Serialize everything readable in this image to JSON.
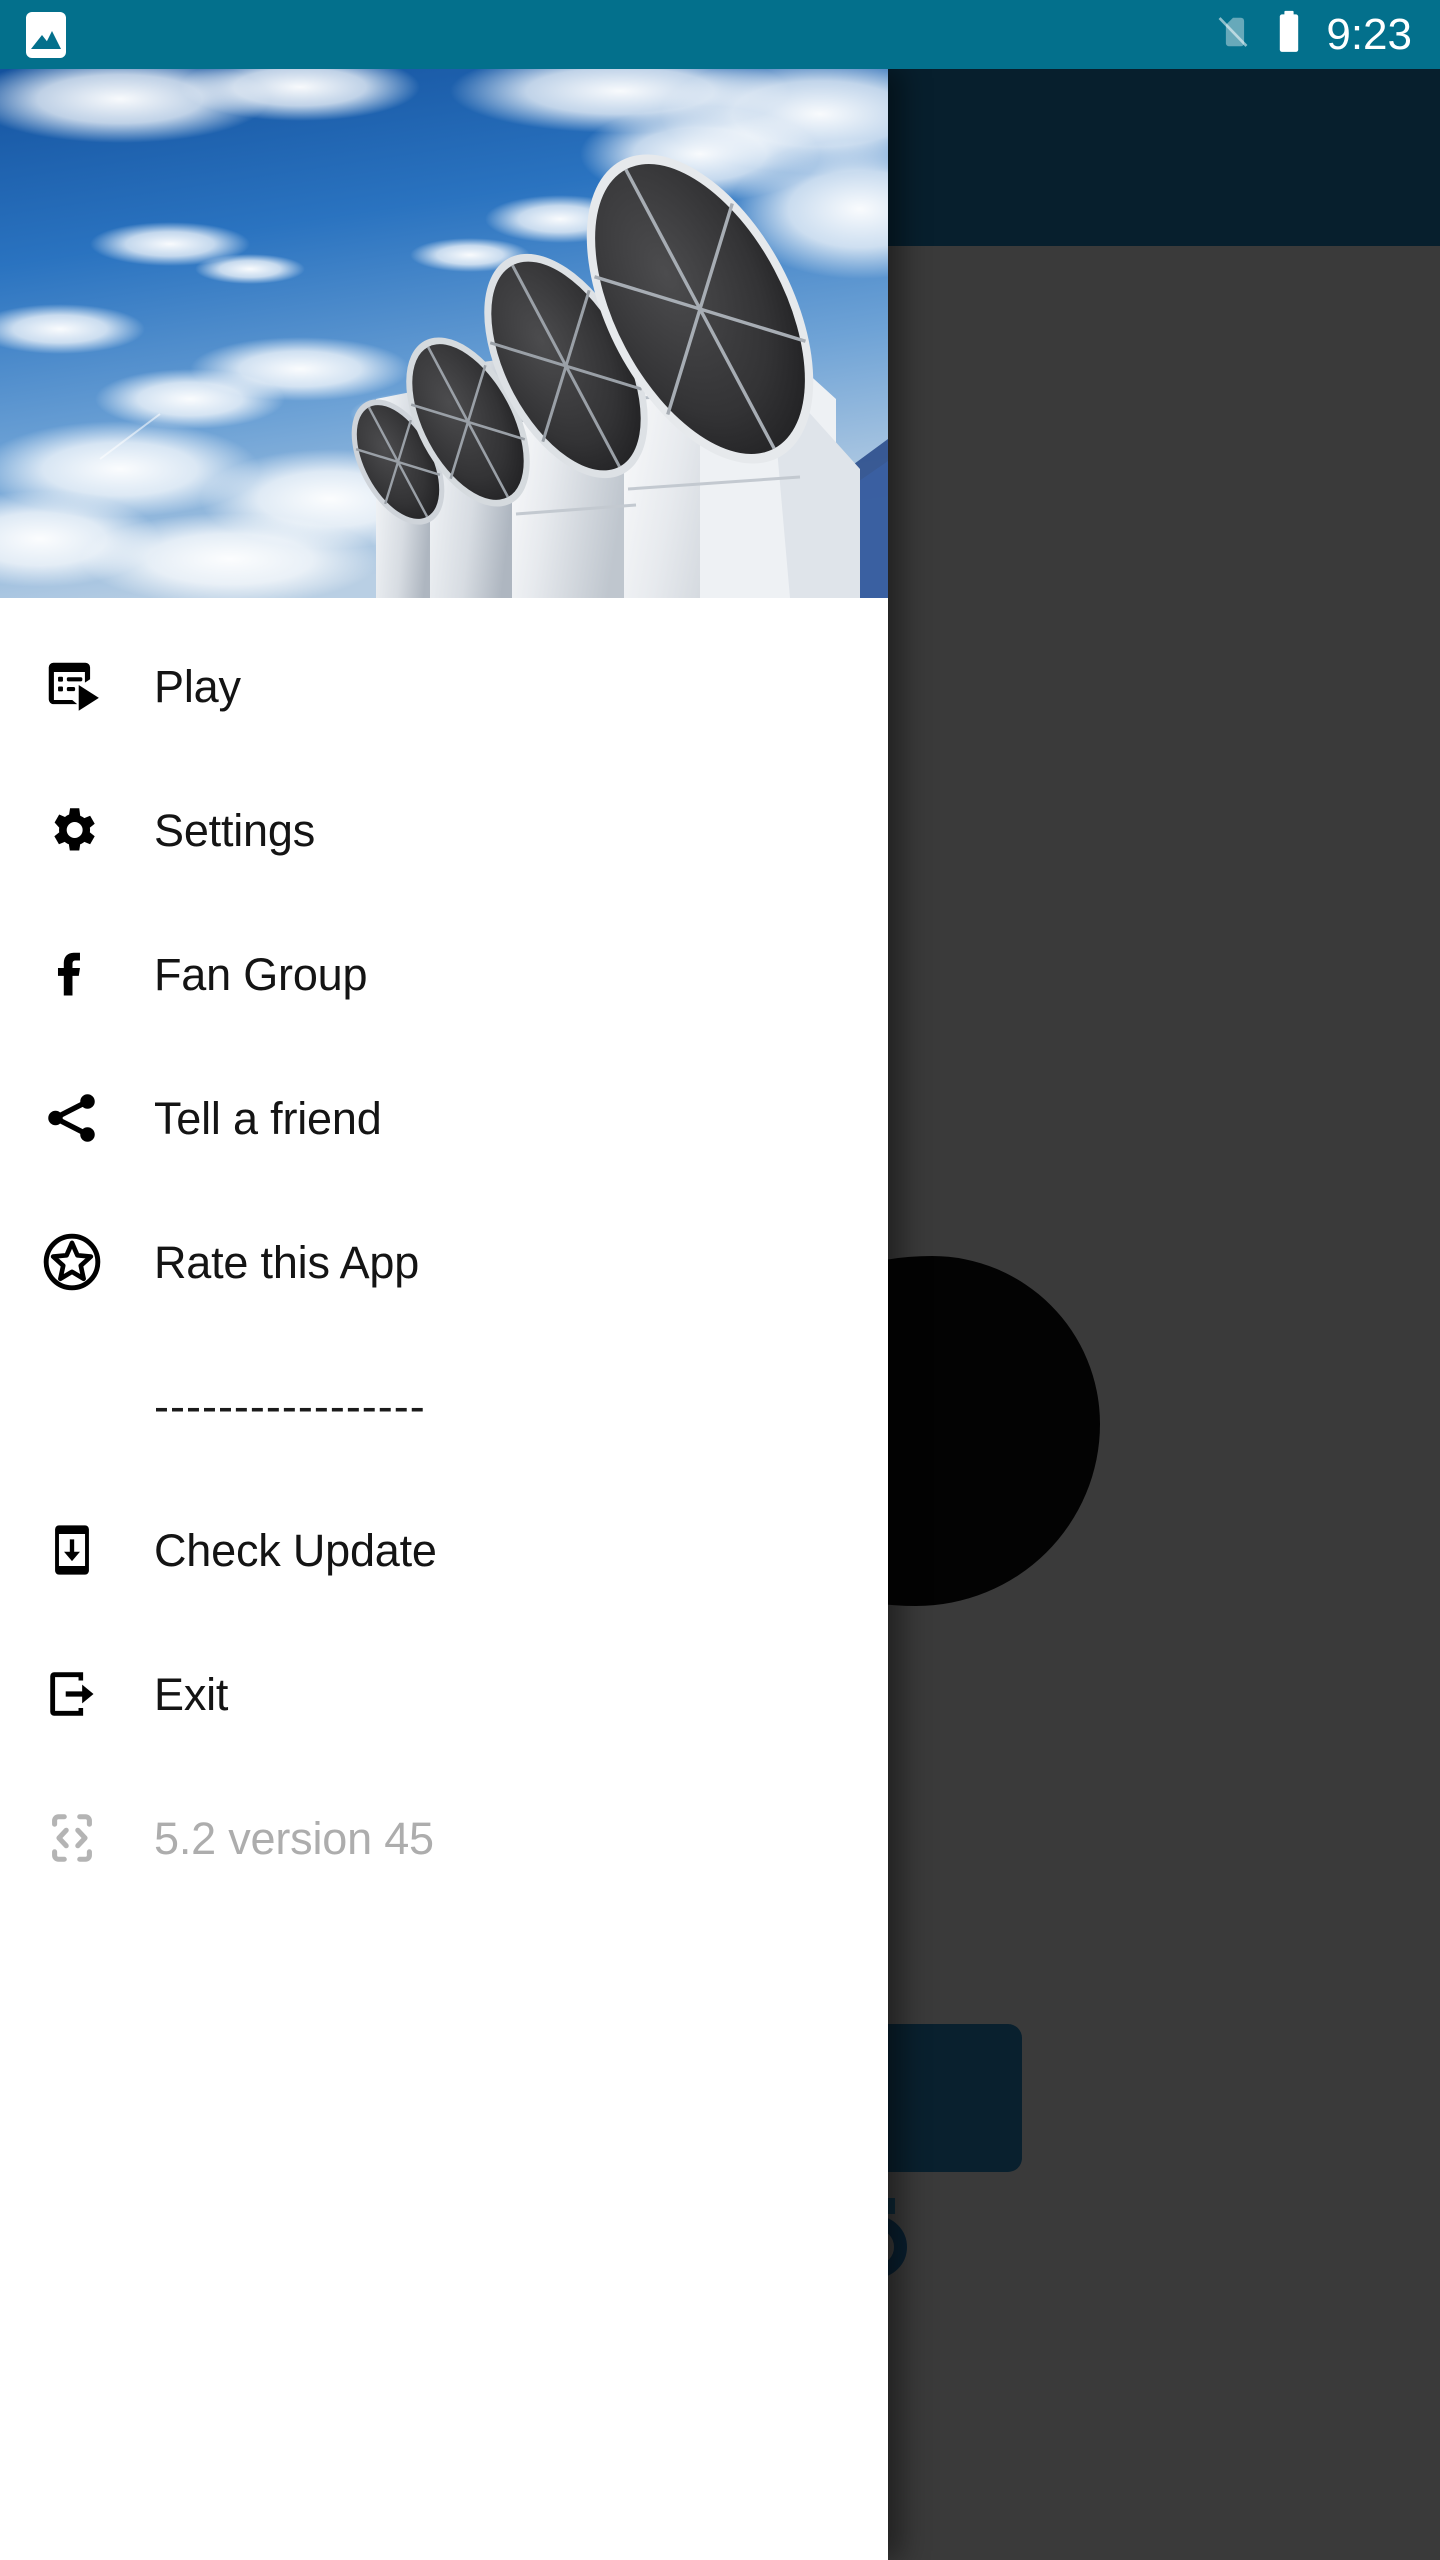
{
  "status_bar": {
    "background_color": "#03708C",
    "notification_icon": "photo-icon",
    "sim_icon": "no-sim-icon",
    "battery_icon": "battery-full-icon",
    "time": "9:23"
  },
  "background_app": {
    "appbar_color": "#0D3A53",
    "body_color": "#6A6A6A",
    "card_color": "#113B55",
    "blob_color": "#070707"
  },
  "drawer": {
    "background_color": "#FFFFFF",
    "header": {
      "image_alt": "industrial ventilation fans against blue cloudy sky",
      "sky_color": "#1D5FA8",
      "duct_color": "#E8EAEC",
      "vent_color": "#3A3A3C"
    },
    "items": [
      {
        "id": "play",
        "label": "Play",
        "icon": "slideshow-play-icon",
        "enabled": true
      },
      {
        "id": "settings",
        "label": "Settings",
        "icon": "gear-icon",
        "enabled": true
      },
      {
        "id": "fan-group",
        "label": "Fan Group",
        "icon": "facebook-icon",
        "enabled": true
      },
      {
        "id": "tell-friend",
        "label": "Tell a friend",
        "icon": "share-icon",
        "enabled": true
      },
      {
        "id": "rate-app",
        "label": "Rate this App",
        "icon": "star-circle-icon",
        "enabled": true
      }
    ],
    "divider": "-----------------",
    "items_secondary": [
      {
        "id": "check-update",
        "label": "Check Update",
        "icon": "phone-download-icon",
        "enabled": true
      },
      {
        "id": "exit",
        "label": "Exit",
        "icon": "exit-door-icon",
        "enabled": true
      }
    ],
    "version_row": {
      "id": "version",
      "label": "5.2  version 45",
      "icon": "code-brackets-icon",
      "enabled": false,
      "text_color": "#ADADAD"
    }
  }
}
